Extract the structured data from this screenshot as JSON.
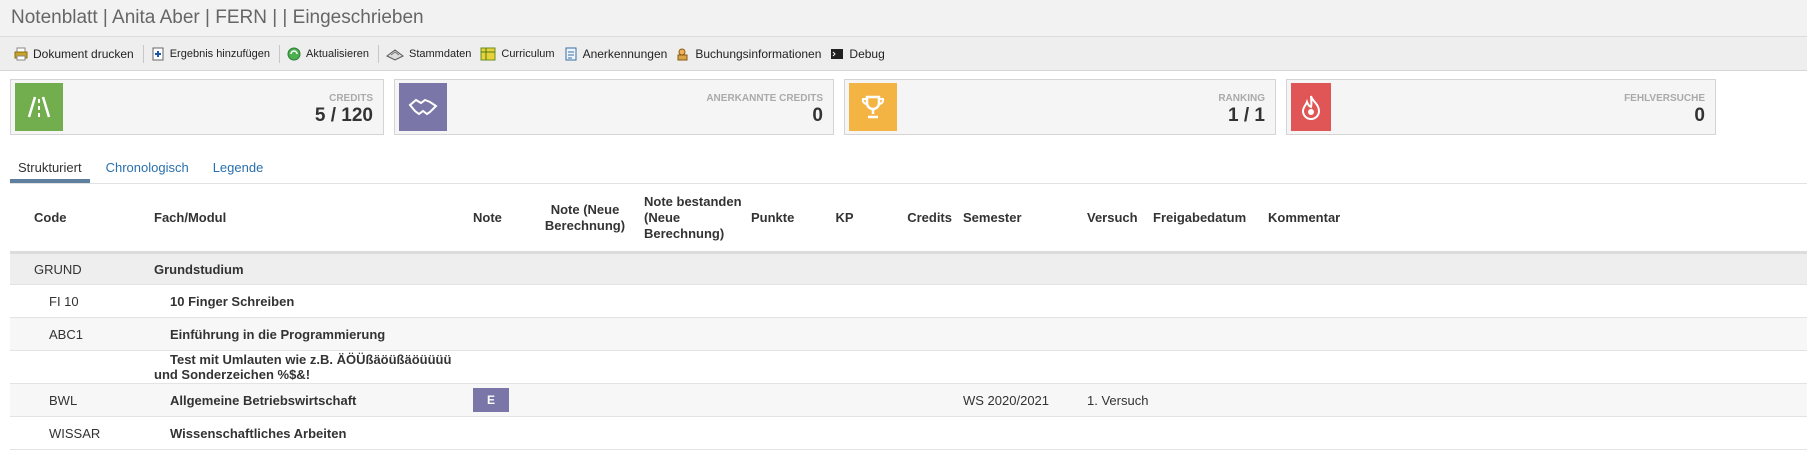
{
  "header": {
    "title": "Notenblatt | Anita Aber | FERN | | Eingeschrieben"
  },
  "toolbar": {
    "items": [
      {
        "label": "Dokument drucken",
        "icon": "print-icon"
      },
      {
        "label": "Ergebnis hinzufügen",
        "icon": "add-document-icon"
      },
      {
        "label": "Aktualisieren",
        "icon": "refresh-icon"
      },
      {
        "label": "Stammdaten",
        "icon": "masterdata-icon"
      },
      {
        "label": "Curriculum",
        "icon": "curriculum-icon"
      },
      {
        "label": "Anerkennungen",
        "icon": "recognition-icon"
      },
      {
        "label": "Buchungsinformationen",
        "icon": "booking-icon"
      },
      {
        "label": "Debug",
        "icon": "terminal-icon"
      }
    ]
  },
  "cards": [
    {
      "label": "CREDITS",
      "value": "5 / 120",
      "color": "#72ad4e",
      "icon": "road-icon"
    },
    {
      "label": "ANERKANNTE CREDITS",
      "value": "0",
      "color": "#7a77a8",
      "icon": "handshake-icon"
    },
    {
      "label": "RANKING",
      "value": "1 / 1",
      "color": "#f3b443",
      "icon": "trophy-icon"
    },
    {
      "label": "FEHLVERSUCHE",
      "value": "0",
      "color": "#e05555",
      "icon": "fire-icon"
    }
  ],
  "tabs": [
    {
      "label": "Strukturiert",
      "active": true
    },
    {
      "label": "Chronologisch",
      "active": false
    },
    {
      "label": "Legende",
      "active": false
    }
  ],
  "table": {
    "headers": {
      "code": "Code",
      "fach": "Fach/Modul",
      "note": "Note",
      "note_neu": "Note (Neue Berechnung)",
      "note_bestanden": "Note bestanden (Neue Berechnung)",
      "punkte": "Punkte",
      "kp": "KP",
      "credits": "Credits",
      "semester": "Semester",
      "versuch": "Versuch",
      "freigabe": "Freigabedatum",
      "kommentar": "Kommentar"
    },
    "group": {
      "code": "GRUND",
      "name": "Grundstudium"
    },
    "rows": [
      {
        "code": "FI 10",
        "name": "10 Finger Schreiben",
        "note": "",
        "semester": "",
        "versuch": ""
      },
      {
        "code": "ABC1",
        "name": "Einführung in die Programmierung",
        "note": "",
        "semester": "",
        "versuch": ""
      },
      {
        "code": "",
        "name": "Test mit Umlauten wie z.B. ÄÖÜßäöüßäöüüüü und Sonderzeichen %$&!",
        "note": "",
        "semester": "",
        "versuch": ""
      },
      {
        "code": "BWL",
        "name": "Allgemeine Betriebswirtschaft",
        "note": "E",
        "semester": "WS 2020/2021",
        "versuch": "1. Versuch"
      },
      {
        "code": "WISSAR",
        "name": "Wissenschaftliches Arbeiten",
        "note": "",
        "semester": "",
        "versuch": ""
      }
    ]
  }
}
